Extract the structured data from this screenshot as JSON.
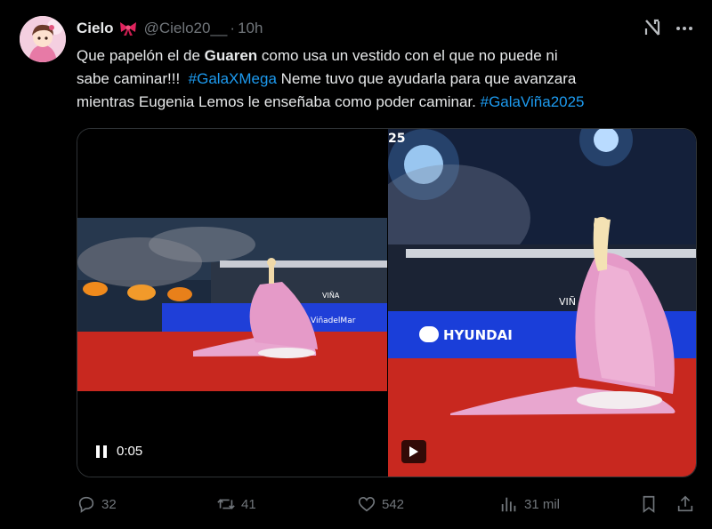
{
  "tweet": {
    "display_name": "Cielo",
    "handle": "@Cielo20__",
    "separator": "·",
    "time": "10h",
    "text": {
      "l1_a": "Que papelón el de ",
      "l1_b": "Guaren",
      "l1_c": " como usa un vestido con el que no puede ni",
      "l2_a": "sabe caminar!!!  ",
      "l2_b": "#GalaXMega",
      "l2_c": " Neme tuvo que ayudarla para que avanzara",
      "l3_a": "mientras Eugenia Lemos le enseñaba como poder caminar. ",
      "l3_b": "#GalaViña2025"
    }
  },
  "media": {
    "left_video": {
      "time": "0:05",
      "sign_text": "ViñadelMar",
      "vina_logo": "VIÑA"
    },
    "right_video": {
      "corner_number": "25",
      "sponsor": "HYUNDAI",
      "vina_logo": "VIÑ"
    }
  },
  "actions": {
    "replies": "32",
    "reposts": "41",
    "likes": "542",
    "views": "31 mil"
  },
  "colors": {
    "background": "#000000",
    "text": "#e7e9ea",
    "muted": "#71767b",
    "link": "#1d9bf0",
    "carpet": "#c8281f",
    "dress": "#e8a6cf"
  },
  "icons": {
    "grok": "grok-icon",
    "more": "more-icon",
    "reply": "reply-icon",
    "repost": "repost-icon",
    "like": "heart-icon",
    "views": "views-icon",
    "bookmark": "bookmark-icon",
    "share": "share-icon"
  }
}
